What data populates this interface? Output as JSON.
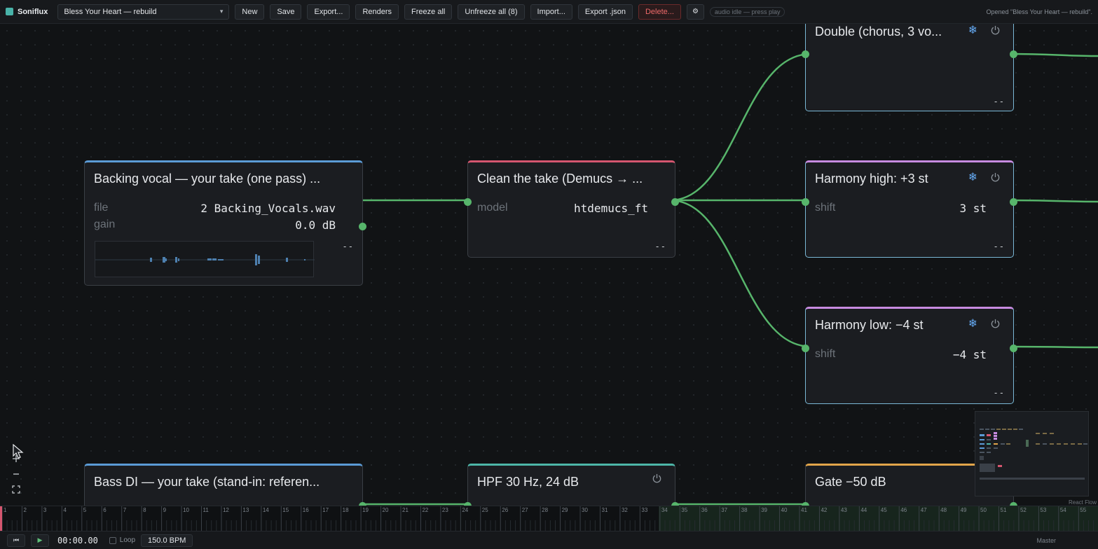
{
  "toolbar": {
    "app_name": "Soniflux",
    "project": "Bless Your Heart — rebuild",
    "buttons": {
      "new": "New",
      "save": "Save",
      "export": "Export...",
      "renders": "Renders",
      "freeze_all": "Freeze all",
      "unfreeze_all": "Unfreeze all (8)",
      "import": "Import...",
      "export_json": "Export .json",
      "delete": "Delete...",
      "settings": "⚙"
    },
    "audio_status": "audio idle — press play",
    "status_message": "Opened \"Bless Your Heart — rebuild\"."
  },
  "nodes": {
    "backing_vocal": {
      "title": "Backing vocal — your take (one pass) ...",
      "file_key": "file",
      "file_val": "2 Backing_Vocals.wav",
      "gain_key": "gain",
      "gain_val": "0.0 dB",
      "status": "--"
    },
    "clean_take": {
      "title": "Clean the take (Demucs → ...",
      "model_key": "model",
      "model_val": "htdemucs_ft",
      "status": "--"
    },
    "double": {
      "title": "Double (chorus, 3 vo...",
      "status": "--"
    },
    "harmony_high": {
      "title": "Harmony high: +3 st",
      "shift_key": "shift",
      "shift_val": "3 st",
      "status": "--"
    },
    "harmony_low": {
      "title": "Harmony low: −4 st",
      "shift_key": "shift",
      "shift_val": "−4 st",
      "status": "--"
    },
    "bass_di": {
      "title": "Bass DI — your take (stand-in: referen..."
    },
    "hpf": {
      "title": "HPF 30 Hz, 24 dB"
    },
    "gate": {
      "title": "Gate −50 dB"
    }
  },
  "icons": {
    "freeze": "❄",
    "power": "power-icon"
  },
  "minimap": {
    "attribution": "React Flow"
  },
  "timeline": {
    "bars": [
      1,
      2,
      3,
      4,
      5,
      6,
      7,
      8,
      9,
      10,
      11,
      12,
      13,
      14,
      15,
      16,
      17,
      18,
      19,
      20,
      21,
      22,
      23,
      24,
      25,
      26,
      27,
      28,
      29,
      30,
      31,
      32,
      33,
      34,
      35,
      36,
      37,
      38,
      39,
      40,
      41,
      42,
      43,
      44,
      45,
      46,
      47,
      48,
      49,
      50,
      51,
      52,
      53,
      54,
      55
    ]
  },
  "transport": {
    "rewind": "⏮",
    "play": "▶",
    "time": "00:00.00",
    "loop_label": "Loop",
    "bpm": "150.0 BPM",
    "master": "Master"
  },
  "colors": {
    "edge": "#57b56b",
    "accent_blue": "#5b9bd6",
    "accent_red": "#d5566f",
    "accent_pink": "#c78be0",
    "accent_teal": "#4db6a8",
    "accent_amber": "#e2a54a",
    "freeze_blue": "#64a8f0"
  }
}
